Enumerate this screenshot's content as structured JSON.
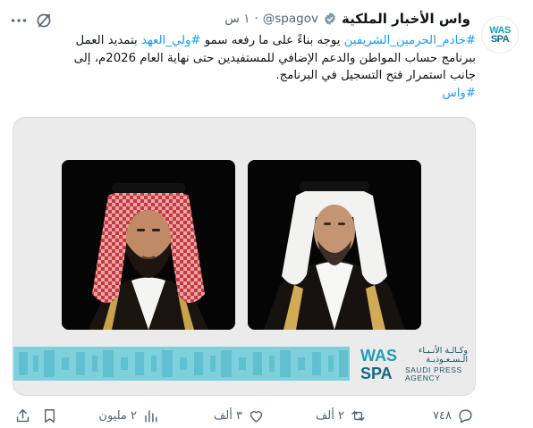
{
  "author": {
    "name": "واس الأخبار الملكية",
    "handle": "@spagov",
    "separator": "·",
    "time": "١ س",
    "avatar_text_top": "WAS",
    "avatar_text_bottom": "SPA"
  },
  "tweet": {
    "lines": [
      [
        {
          "text": "#خادم_الحرمين_الشريفين",
          "tag": true
        },
        {
          "text": " يوجه بناءً على ما رفعه سمو ",
          "tag": false
        },
        {
          "text": "#ولي_العهد",
          "tag": true
        },
        {
          "text": " بتمديد العمل",
          "tag": false
        }
      ],
      [
        {
          "text": "ببرنامج حساب المواطن والدعم الإضافي للمستفيدين حتى نهاية العام 2026م، إلى",
          "tag": false
        }
      ],
      [
        {
          "text": "جانب استمرار فتح التسجيل في البرنامج.",
          "tag": false
        }
      ],
      [
        {
          "text": "#واس",
          "tag": true
        }
      ]
    ]
  },
  "media": {
    "logo_ar_line1": "وكـالـة الأنـبـاء",
    "logo_ar_line2": "الـسـعـوديـة",
    "logo_en_line1": "SAUDI PRESS",
    "logo_en_line2": "AGENCY",
    "logo_mark_top": "WAS",
    "logo_mark_bottom": "SPA"
  },
  "actions": {
    "replies": "٧٤٨",
    "reposts": "٢ ألف",
    "likes": "٣ ألف",
    "views": "٢ مليون"
  },
  "colors": {
    "link": "#1d9bf0",
    "muted": "#536471",
    "verified": "#829aab",
    "spa_teal": "#1d9fb6"
  }
}
